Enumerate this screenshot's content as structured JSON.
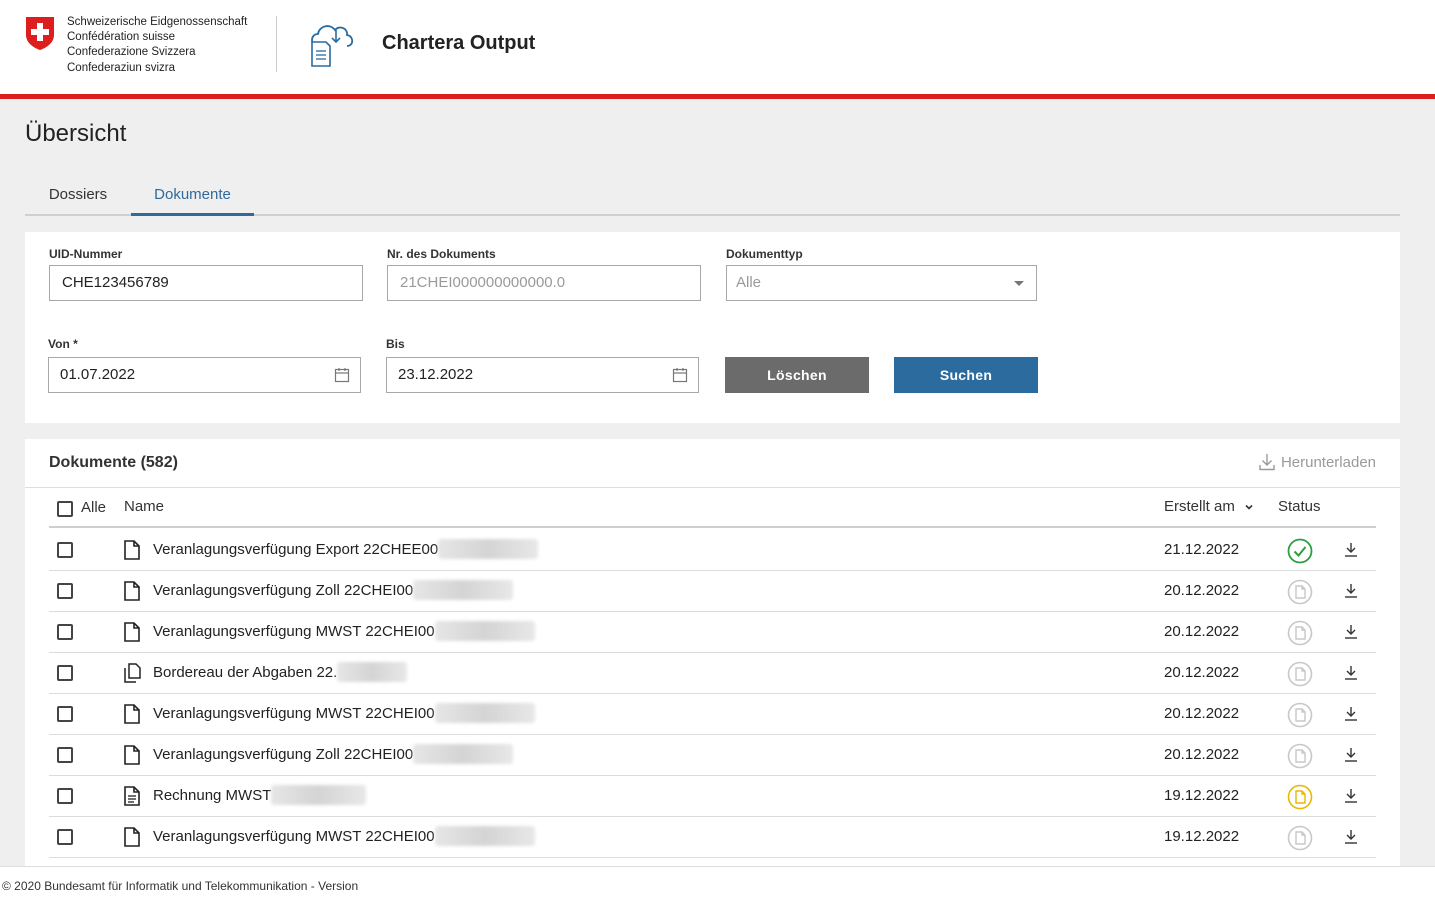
{
  "header": {
    "confederation_lines": [
      "Schweizerische Eidgenossenschaft",
      "Confédération suisse",
      "Confederazione Svizzera",
      "Confederaziun svizra"
    ],
    "app_title": "Chartera Output"
  },
  "page_title": "Übersicht",
  "tabs": [
    {
      "label": "Dossiers",
      "active": false
    },
    {
      "label": "Dokumente",
      "active": true
    }
  ],
  "filters": {
    "uid_label": "UID-Nummer",
    "uid_value": "CHE123456789",
    "docnr_label": "Nr. des Dokuments",
    "docnr_placeholder": "21CHEI000000000000.0",
    "doctype_label": "Dokumenttyp",
    "doctype_value": "Alle",
    "from_label": "Von *",
    "from_value": "01.07.2022",
    "to_label": "Bis",
    "to_value": "23.12.2022",
    "clear_label": "Löschen",
    "search_label": "Suchen"
  },
  "results": {
    "title": "Dokumente (582)",
    "download_label": "Herunterladen",
    "columns": {
      "all": "Alle",
      "name": "Name",
      "created": "Erstellt am",
      "status": "Status"
    },
    "rows": [
      {
        "name": "Veranlagungsverfügung Export 22CHEE00",
        "date": "21.12.2022",
        "status": "done",
        "icon": "document-icon"
      },
      {
        "name": "Veranlagungsverfügung Zoll 22CHEI00",
        "date": "20.12.2022",
        "status": "pending",
        "icon": "document-icon"
      },
      {
        "name": "Veranlagungsverfügung MWST 22CHEI00",
        "date": "20.12.2022",
        "status": "pending",
        "icon": "document-icon"
      },
      {
        "name": "Bordereau der Abgaben 22.",
        "date": "20.12.2022",
        "status": "pending",
        "icon": "documents-stack-icon"
      },
      {
        "name": "Veranlagungsverfügung MWST 22CHEI00",
        "date": "20.12.2022",
        "status": "pending",
        "icon": "document-icon"
      },
      {
        "name": "Veranlagungsverfügung Zoll 22CHEI00",
        "date": "20.12.2022",
        "status": "pending",
        "icon": "document-icon"
      },
      {
        "name": "Rechnung MWST",
        "date": "19.12.2022",
        "status": "warning",
        "icon": "invoice-icon"
      },
      {
        "name": "Veranlagungsverfügung MWST 22CHEI00",
        "date": "19.12.2022",
        "status": "pending",
        "icon": "document-icon"
      }
    ]
  },
  "footer": "© 2020 Bundesamt für Informatik und Telekommunikation - Version",
  "colors": {
    "accent_red": "#dc1e1e",
    "primary_blue": "#2b6b9e",
    "tab_blue": "#2f6a9b",
    "success_green": "#2e9e3e",
    "warning_yellow": "#e8b800",
    "pending_grey": "#c8c8c8"
  }
}
